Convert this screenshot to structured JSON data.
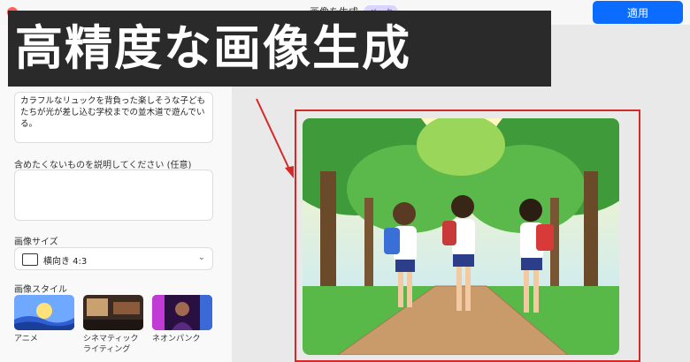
{
  "dialog": {
    "title": "画像を生成",
    "badge": "ベータ",
    "apply_label": "適用"
  },
  "banner": {
    "text": "高精度な画像生成"
  },
  "prompt": {
    "text": "カラフルなリュックを背負った楽しそうな子どもたちが光が差し込む学校までの並木道で遊んでいる。"
  },
  "negative": {
    "label": "含めたくないものを説明してください (任意)",
    "value": ""
  },
  "size": {
    "label": "画像サイズ",
    "value": "横向き 4:3"
  },
  "styles": {
    "label": "画像スタイル",
    "items": [
      {
        "label": "アニメ"
      },
      {
        "label": "シネマティック ライティング"
      },
      {
        "label": "ネオンパンク"
      }
    ]
  },
  "colors": {
    "accent": "#0b6cff",
    "highlight_frame": "#d62828",
    "banner_bg": "#2a2a2a"
  }
}
